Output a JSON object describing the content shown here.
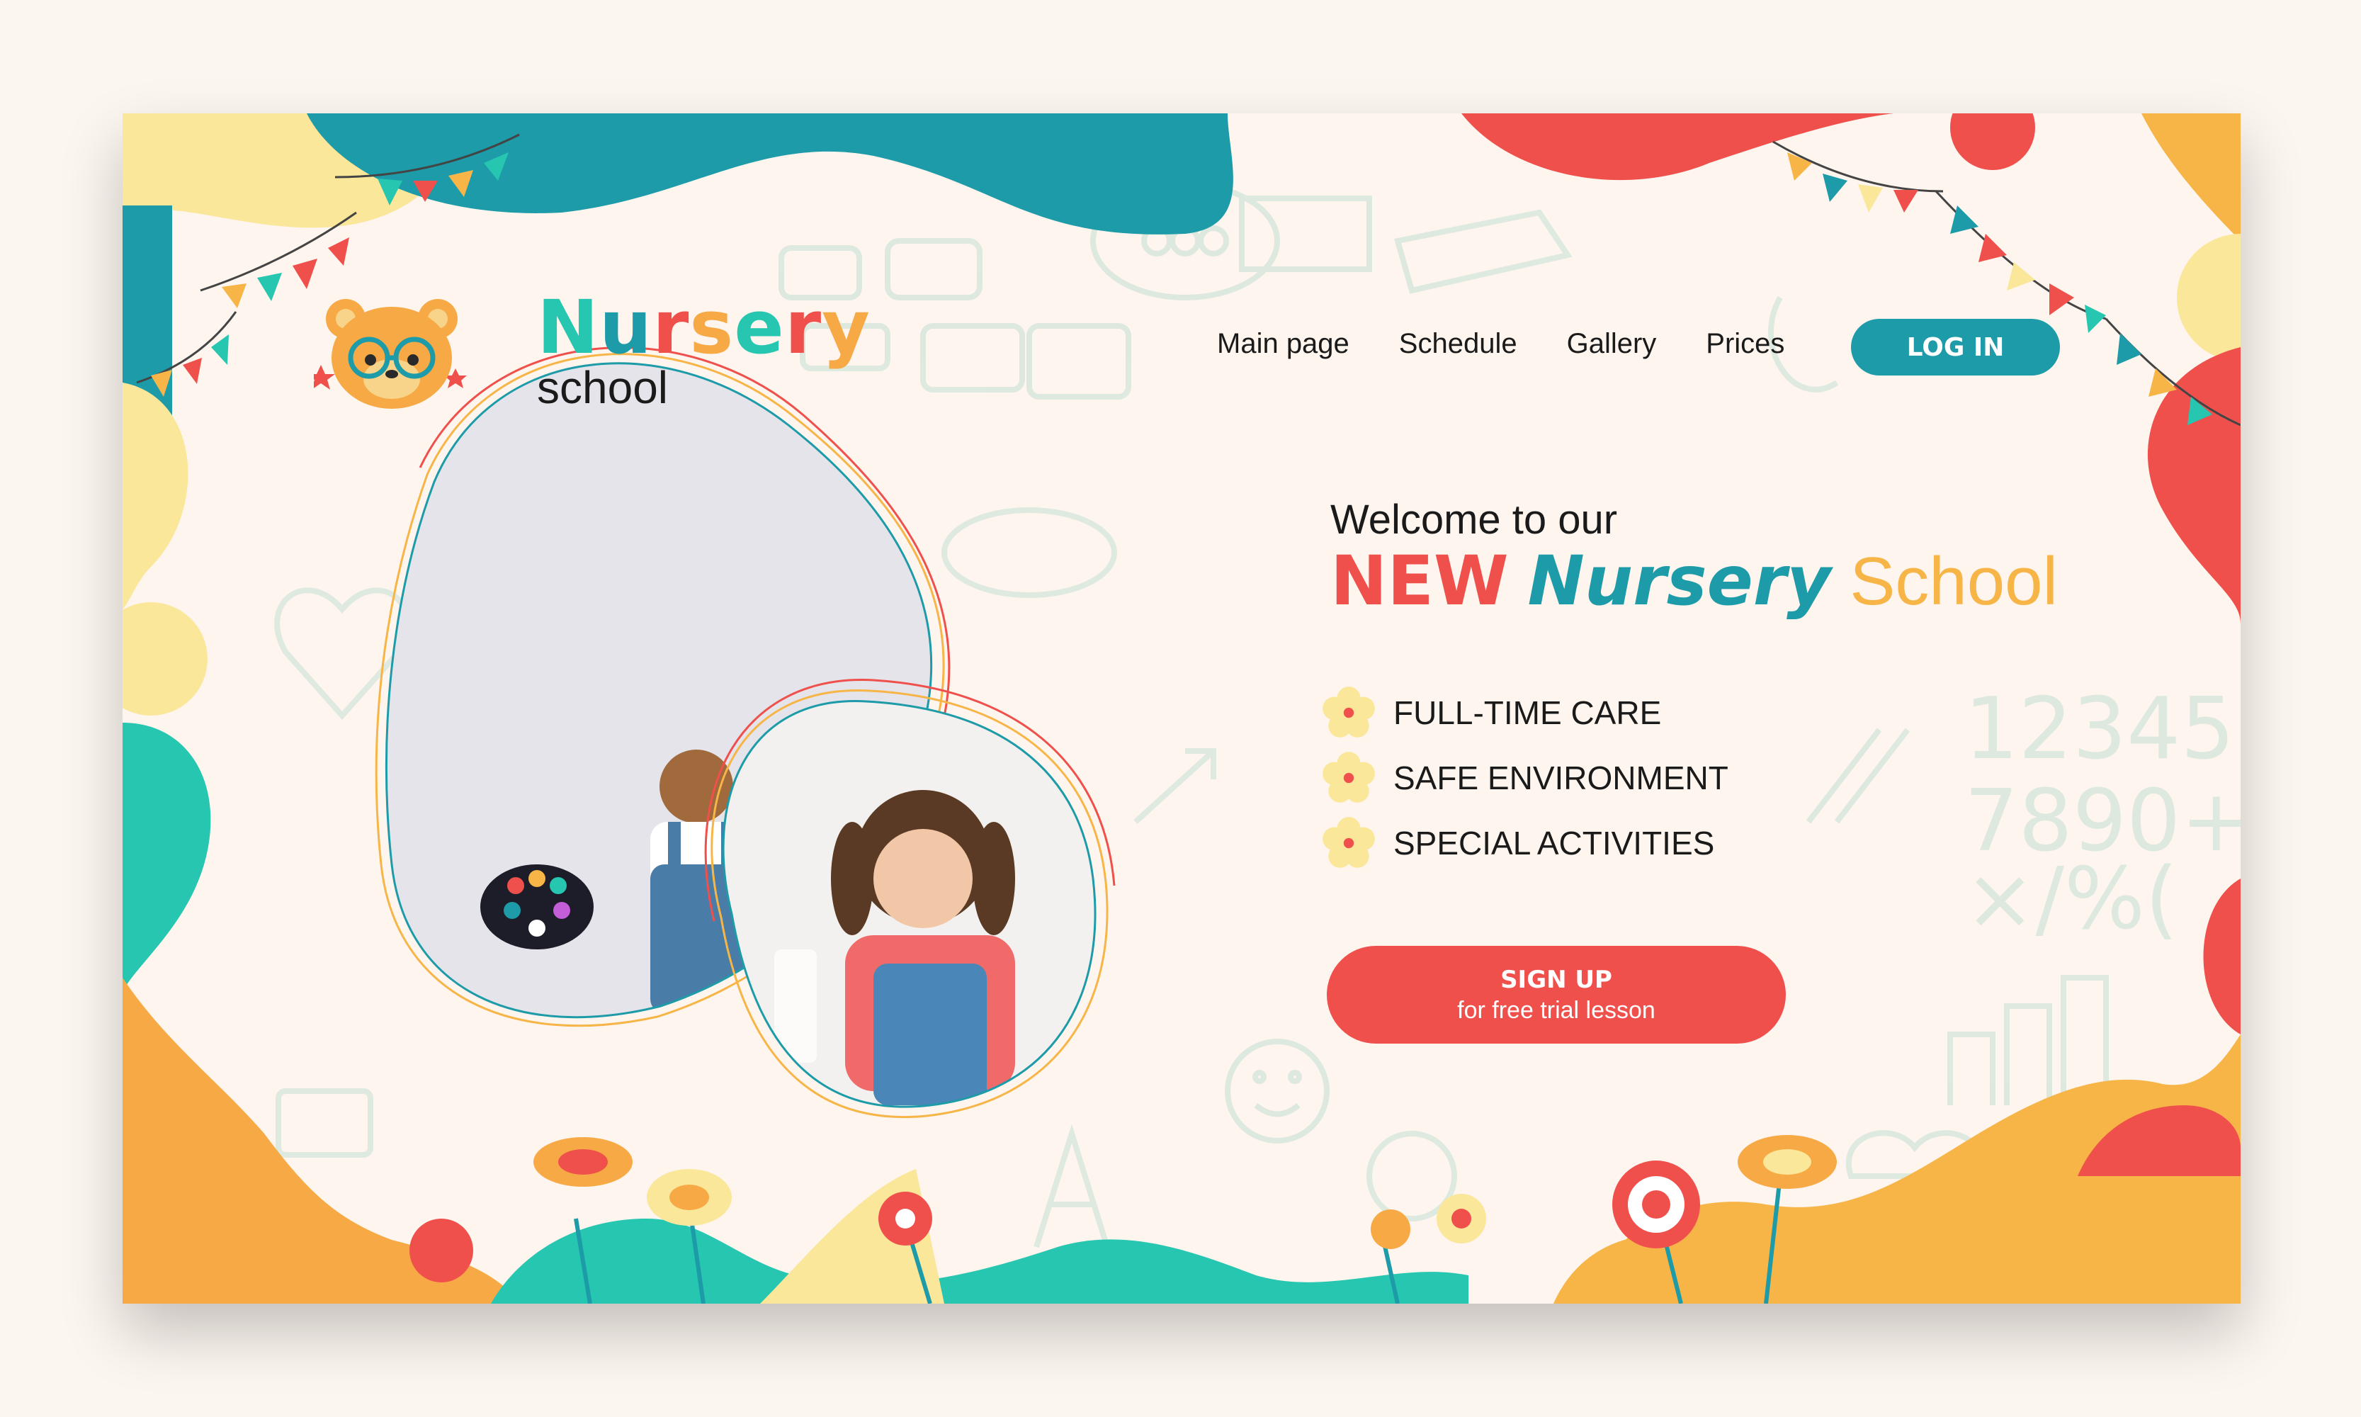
{
  "brand": {
    "name_word1": "Nursery",
    "name_word2": "school",
    "mascot": "bear-with-glasses-icon"
  },
  "nav": {
    "items": [
      {
        "label": "Main page"
      },
      {
        "label": "Schedule"
      },
      {
        "label": "Gallery"
      },
      {
        "label": "Prices"
      }
    ],
    "login_label": "LOG IN"
  },
  "hero": {
    "welcome": "Welcome to our",
    "headline_new": "NEW",
    "headline_nursery": "Nursery",
    "headline_school": "School",
    "features": [
      {
        "label": "FULL-TIME CARE",
        "icon": "flower-bullet-icon"
      },
      {
        "label": "SAFE ENVIRONMENT",
        "icon": "flower-bullet-icon"
      },
      {
        "label": "SPECIAL ACTIVITIES",
        "icon": "flower-bullet-icon"
      }
    ],
    "signup_main": "SIGN UP",
    "signup_sub": "for free trial lesson"
  },
  "colors": {
    "teal": "#1d9ba8",
    "mint": "#26c6b0",
    "red": "#f0504c",
    "orange": "#f7a945",
    "yellow": "#fbe79a",
    "background": "#fdf5ee"
  }
}
